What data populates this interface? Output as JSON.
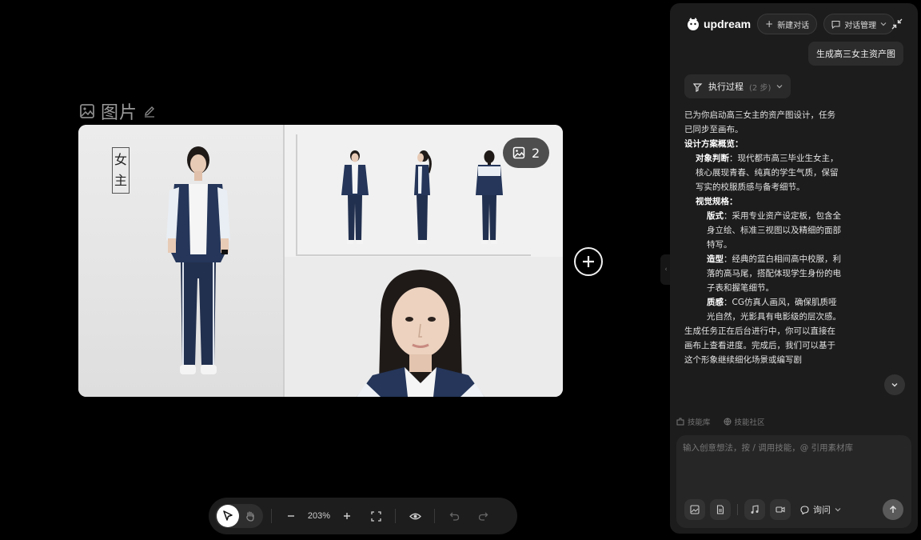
{
  "canvas": {
    "node_title": "图片",
    "image_count": "2",
    "vertical_label": [
      "女",
      "主"
    ]
  },
  "toolbar": {
    "zoom": "203%"
  },
  "chat": {
    "brand": "updream",
    "new_chat": "新建对话",
    "chat_manage": "对话管理",
    "user_message": "生成高三女主资产图",
    "exec_label": "执行过程",
    "exec_steps": "(2 步)",
    "response": {
      "intro": "已为你启动高三女主的资产图设计，任务已同步至画布。",
      "overview_title": "设计方案概览",
      "judge_title": "对象判断",
      "judge_text": "：现代都市高三毕业生女主，核心展现青春、纯真的学生气质，保留写实的校服质感与备考细节。",
      "visual_title": "视觉规格",
      "layout_title": "版式",
      "layout_text": "：采用专业资产设定板，包含全身立绘、标准三视图以及精细的面部特写。",
      "shape_title": "造型",
      "shape_text": "：经典的蓝白相间高中校服，利落的高马尾，搭配体现学生身份的电子表和握笔细节。",
      "texture_title": "质感",
      "texture_text": "：CG仿真人画风，确保肌质哑光自然，光影具有电影级的层次感。",
      "footer": "生成任务正在后台进行中，你可以直接在画布上查看进度。完成后，我们可以基于这个形象继续细化场景或编写剧"
    },
    "skill_library": "技能库",
    "skill_community": "技能社区",
    "input_placeholder": "输入创意想法，按 / 调用技能，@ 引用素材库",
    "mode": "询问"
  }
}
